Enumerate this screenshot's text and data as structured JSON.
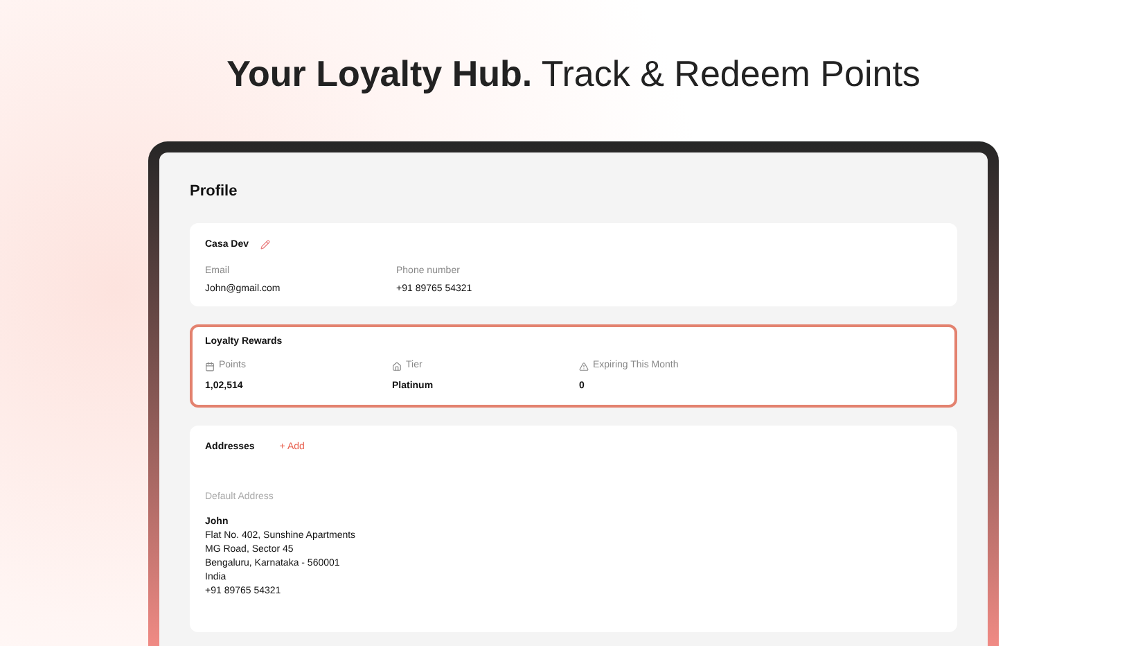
{
  "headline": "**Your Loyalty Hub.** Track & Redeem Points",
  "page_title": "Profile",
  "profile": {
    "name": "Casa Dev",
    "fields": [
      {
        "label": "Email",
        "value": "John@gmail.com"
      },
      {
        "label": "Phone number",
        "value": "+91 89765 54321"
      }
    ]
  },
  "loyalty": {
    "title": "Loyalty Rewards",
    "stats": [
      {
        "kind": "calendar",
        "label": "Points",
        "value": "1,02,514"
      },
      {
        "kind": "tier",
        "label": "Tier",
        "value": "Platinum"
      },
      {
        "kind": "warning",
        "label": "Expiring This Month",
        "value": "0"
      }
    ]
  },
  "addresses": {
    "title": "Addresses",
    "add": "+ Add",
    "default_label": "Default Address",
    "lines": [
      "John",
      "Flat No. 402, Sunshine Apartments",
      "MG Road, Sector 45",
      "Bengaluru, Karnataka - 560001",
      "India",
      "+91 89765 54321"
    ]
  }
}
